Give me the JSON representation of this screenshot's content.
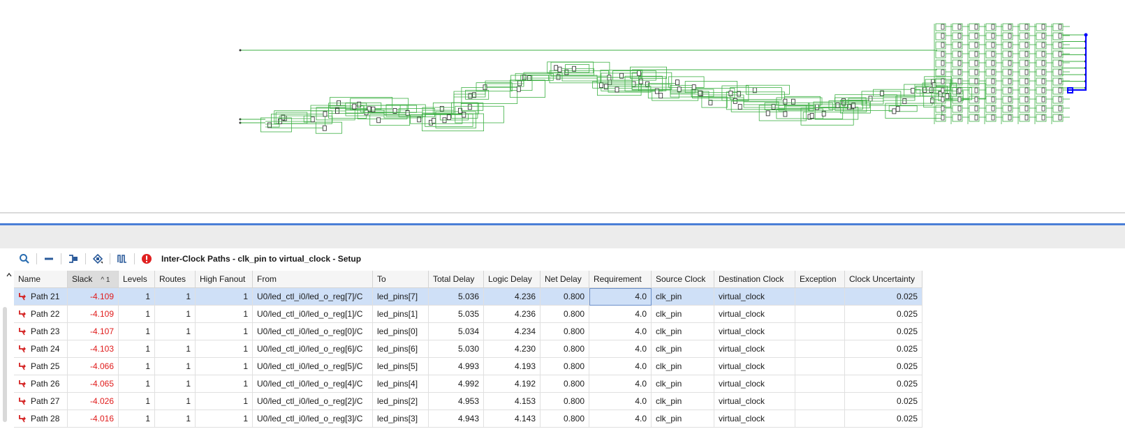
{
  "toolbar": {
    "title": "Inter-Clock Paths - clk_pin to virtual_clock - Setup",
    "buttons": [
      "search-icon",
      "collapse-icon",
      "schematic-icon",
      "hierarchy-icon",
      "waveform-icon",
      "error-icon"
    ]
  },
  "colors": {
    "schematic_line": "#3cb043",
    "highlight": "#0000ff",
    "slack_negative": "#e01b1b",
    "selection": "#cfe0f7",
    "accent": "#4a7ed6"
  },
  "table": {
    "sort_indicator": "^ 1",
    "columns": [
      "Name",
      "Slack",
      "Levels",
      "Routes",
      "High Fanout",
      "From",
      "To",
      "Total Delay",
      "Logic Delay",
      "Net Delay",
      "Requirement",
      "Source Clock",
      "Destination Clock",
      "Exception",
      "Clock Uncertainty"
    ],
    "rows": [
      [
        "Path 21",
        "-4.109",
        "1",
        "1",
        "1",
        "U0/led_ctl_i0/led_o_reg[7]/C",
        "led_pins[7]",
        "5.036",
        "4.236",
        "0.800",
        "4.0",
        "clk_pin",
        "virtual_clock",
        "",
        "0.025"
      ],
      [
        "Path 22",
        "-4.109",
        "1",
        "1",
        "1",
        "U0/led_ctl_i0/led_o_reg[1]/C",
        "led_pins[1]",
        "5.035",
        "4.236",
        "0.800",
        "4.0",
        "clk_pin",
        "virtual_clock",
        "",
        "0.025"
      ],
      [
        "Path 23",
        "-4.107",
        "1",
        "1",
        "1",
        "U0/led_ctl_i0/led_o_reg[0]/C",
        "led_pins[0]",
        "5.034",
        "4.234",
        "0.800",
        "4.0",
        "clk_pin",
        "virtual_clock",
        "",
        "0.025"
      ],
      [
        "Path 24",
        "-4.103",
        "1",
        "1",
        "1",
        "U0/led_ctl_i0/led_o_reg[6]/C",
        "led_pins[6]",
        "5.030",
        "4.230",
        "0.800",
        "4.0",
        "clk_pin",
        "virtual_clock",
        "",
        "0.025"
      ],
      [
        "Path 25",
        "-4.066",
        "1",
        "1",
        "1",
        "U0/led_ctl_i0/led_o_reg[5]/C",
        "led_pins[5]",
        "4.993",
        "4.193",
        "0.800",
        "4.0",
        "clk_pin",
        "virtual_clock",
        "",
        "0.025"
      ],
      [
        "Path 26",
        "-4.065",
        "1",
        "1",
        "1",
        "U0/led_ctl_i0/led_o_reg[4]/C",
        "led_pins[4]",
        "4.992",
        "4.192",
        "0.800",
        "4.0",
        "clk_pin",
        "virtual_clock",
        "",
        "0.025"
      ],
      [
        "Path 27",
        "-4.026",
        "1",
        "1",
        "1",
        "U0/led_ctl_i0/led_o_reg[2]/C",
        "led_pins[2]",
        "4.953",
        "4.153",
        "0.800",
        "4.0",
        "clk_pin",
        "virtual_clock",
        "",
        "0.025"
      ],
      [
        "Path 28",
        "-4.016",
        "1",
        "1",
        "1",
        "U0/led_ctl_i0/led_o_reg[3]/C",
        "led_pins[3]",
        "4.943",
        "4.143",
        "0.800",
        "4.0",
        "clk_pin",
        "virtual_clock",
        "",
        "0.025"
      ]
    ]
  }
}
